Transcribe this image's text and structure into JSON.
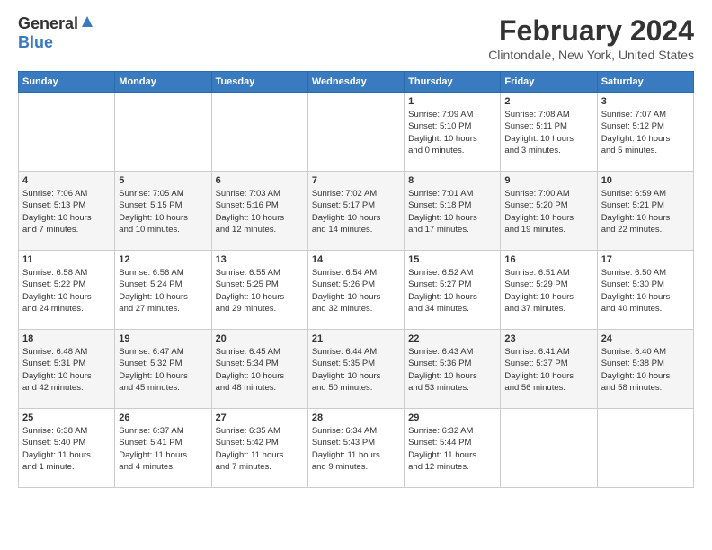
{
  "logo": {
    "general": "General",
    "blue": "Blue"
  },
  "title": "February 2024",
  "subtitle": "Clintondale, New York, United States",
  "days_of_week": [
    "Sunday",
    "Monday",
    "Tuesday",
    "Wednesday",
    "Thursday",
    "Friday",
    "Saturday"
  ],
  "weeks": [
    [
      {
        "day": "",
        "content": ""
      },
      {
        "day": "",
        "content": ""
      },
      {
        "day": "",
        "content": ""
      },
      {
        "day": "",
        "content": ""
      },
      {
        "day": "1",
        "content": "Sunrise: 7:09 AM\nSunset: 5:10 PM\nDaylight: 10 hours\nand 0 minutes."
      },
      {
        "day": "2",
        "content": "Sunrise: 7:08 AM\nSunset: 5:11 PM\nDaylight: 10 hours\nand 3 minutes."
      },
      {
        "day": "3",
        "content": "Sunrise: 7:07 AM\nSunset: 5:12 PM\nDaylight: 10 hours\nand 5 minutes."
      }
    ],
    [
      {
        "day": "4",
        "content": "Sunrise: 7:06 AM\nSunset: 5:13 PM\nDaylight: 10 hours\nand 7 minutes."
      },
      {
        "day": "5",
        "content": "Sunrise: 7:05 AM\nSunset: 5:15 PM\nDaylight: 10 hours\nand 10 minutes."
      },
      {
        "day": "6",
        "content": "Sunrise: 7:03 AM\nSunset: 5:16 PM\nDaylight: 10 hours\nand 12 minutes."
      },
      {
        "day": "7",
        "content": "Sunrise: 7:02 AM\nSunset: 5:17 PM\nDaylight: 10 hours\nand 14 minutes."
      },
      {
        "day": "8",
        "content": "Sunrise: 7:01 AM\nSunset: 5:18 PM\nDaylight: 10 hours\nand 17 minutes."
      },
      {
        "day": "9",
        "content": "Sunrise: 7:00 AM\nSunset: 5:20 PM\nDaylight: 10 hours\nand 19 minutes."
      },
      {
        "day": "10",
        "content": "Sunrise: 6:59 AM\nSunset: 5:21 PM\nDaylight: 10 hours\nand 22 minutes."
      }
    ],
    [
      {
        "day": "11",
        "content": "Sunrise: 6:58 AM\nSunset: 5:22 PM\nDaylight: 10 hours\nand 24 minutes."
      },
      {
        "day": "12",
        "content": "Sunrise: 6:56 AM\nSunset: 5:24 PM\nDaylight: 10 hours\nand 27 minutes."
      },
      {
        "day": "13",
        "content": "Sunrise: 6:55 AM\nSunset: 5:25 PM\nDaylight: 10 hours\nand 29 minutes."
      },
      {
        "day": "14",
        "content": "Sunrise: 6:54 AM\nSunset: 5:26 PM\nDaylight: 10 hours\nand 32 minutes."
      },
      {
        "day": "15",
        "content": "Sunrise: 6:52 AM\nSunset: 5:27 PM\nDaylight: 10 hours\nand 34 minutes."
      },
      {
        "day": "16",
        "content": "Sunrise: 6:51 AM\nSunset: 5:29 PM\nDaylight: 10 hours\nand 37 minutes."
      },
      {
        "day": "17",
        "content": "Sunrise: 6:50 AM\nSunset: 5:30 PM\nDaylight: 10 hours\nand 40 minutes."
      }
    ],
    [
      {
        "day": "18",
        "content": "Sunrise: 6:48 AM\nSunset: 5:31 PM\nDaylight: 10 hours\nand 42 minutes."
      },
      {
        "day": "19",
        "content": "Sunrise: 6:47 AM\nSunset: 5:32 PM\nDaylight: 10 hours\nand 45 minutes."
      },
      {
        "day": "20",
        "content": "Sunrise: 6:45 AM\nSunset: 5:34 PM\nDaylight: 10 hours\nand 48 minutes."
      },
      {
        "day": "21",
        "content": "Sunrise: 6:44 AM\nSunset: 5:35 PM\nDaylight: 10 hours\nand 50 minutes."
      },
      {
        "day": "22",
        "content": "Sunrise: 6:43 AM\nSunset: 5:36 PM\nDaylight: 10 hours\nand 53 minutes."
      },
      {
        "day": "23",
        "content": "Sunrise: 6:41 AM\nSunset: 5:37 PM\nDaylight: 10 hours\nand 56 minutes."
      },
      {
        "day": "24",
        "content": "Sunrise: 6:40 AM\nSunset: 5:38 PM\nDaylight: 10 hours\nand 58 minutes."
      }
    ],
    [
      {
        "day": "25",
        "content": "Sunrise: 6:38 AM\nSunset: 5:40 PM\nDaylight: 11 hours\nand 1 minute."
      },
      {
        "day": "26",
        "content": "Sunrise: 6:37 AM\nSunset: 5:41 PM\nDaylight: 11 hours\nand 4 minutes."
      },
      {
        "day": "27",
        "content": "Sunrise: 6:35 AM\nSunset: 5:42 PM\nDaylight: 11 hours\nand 7 minutes."
      },
      {
        "day": "28",
        "content": "Sunrise: 6:34 AM\nSunset: 5:43 PM\nDaylight: 11 hours\nand 9 minutes."
      },
      {
        "day": "29",
        "content": "Sunrise: 6:32 AM\nSunset: 5:44 PM\nDaylight: 11 hours\nand 12 minutes."
      },
      {
        "day": "",
        "content": ""
      },
      {
        "day": "",
        "content": ""
      }
    ]
  ]
}
